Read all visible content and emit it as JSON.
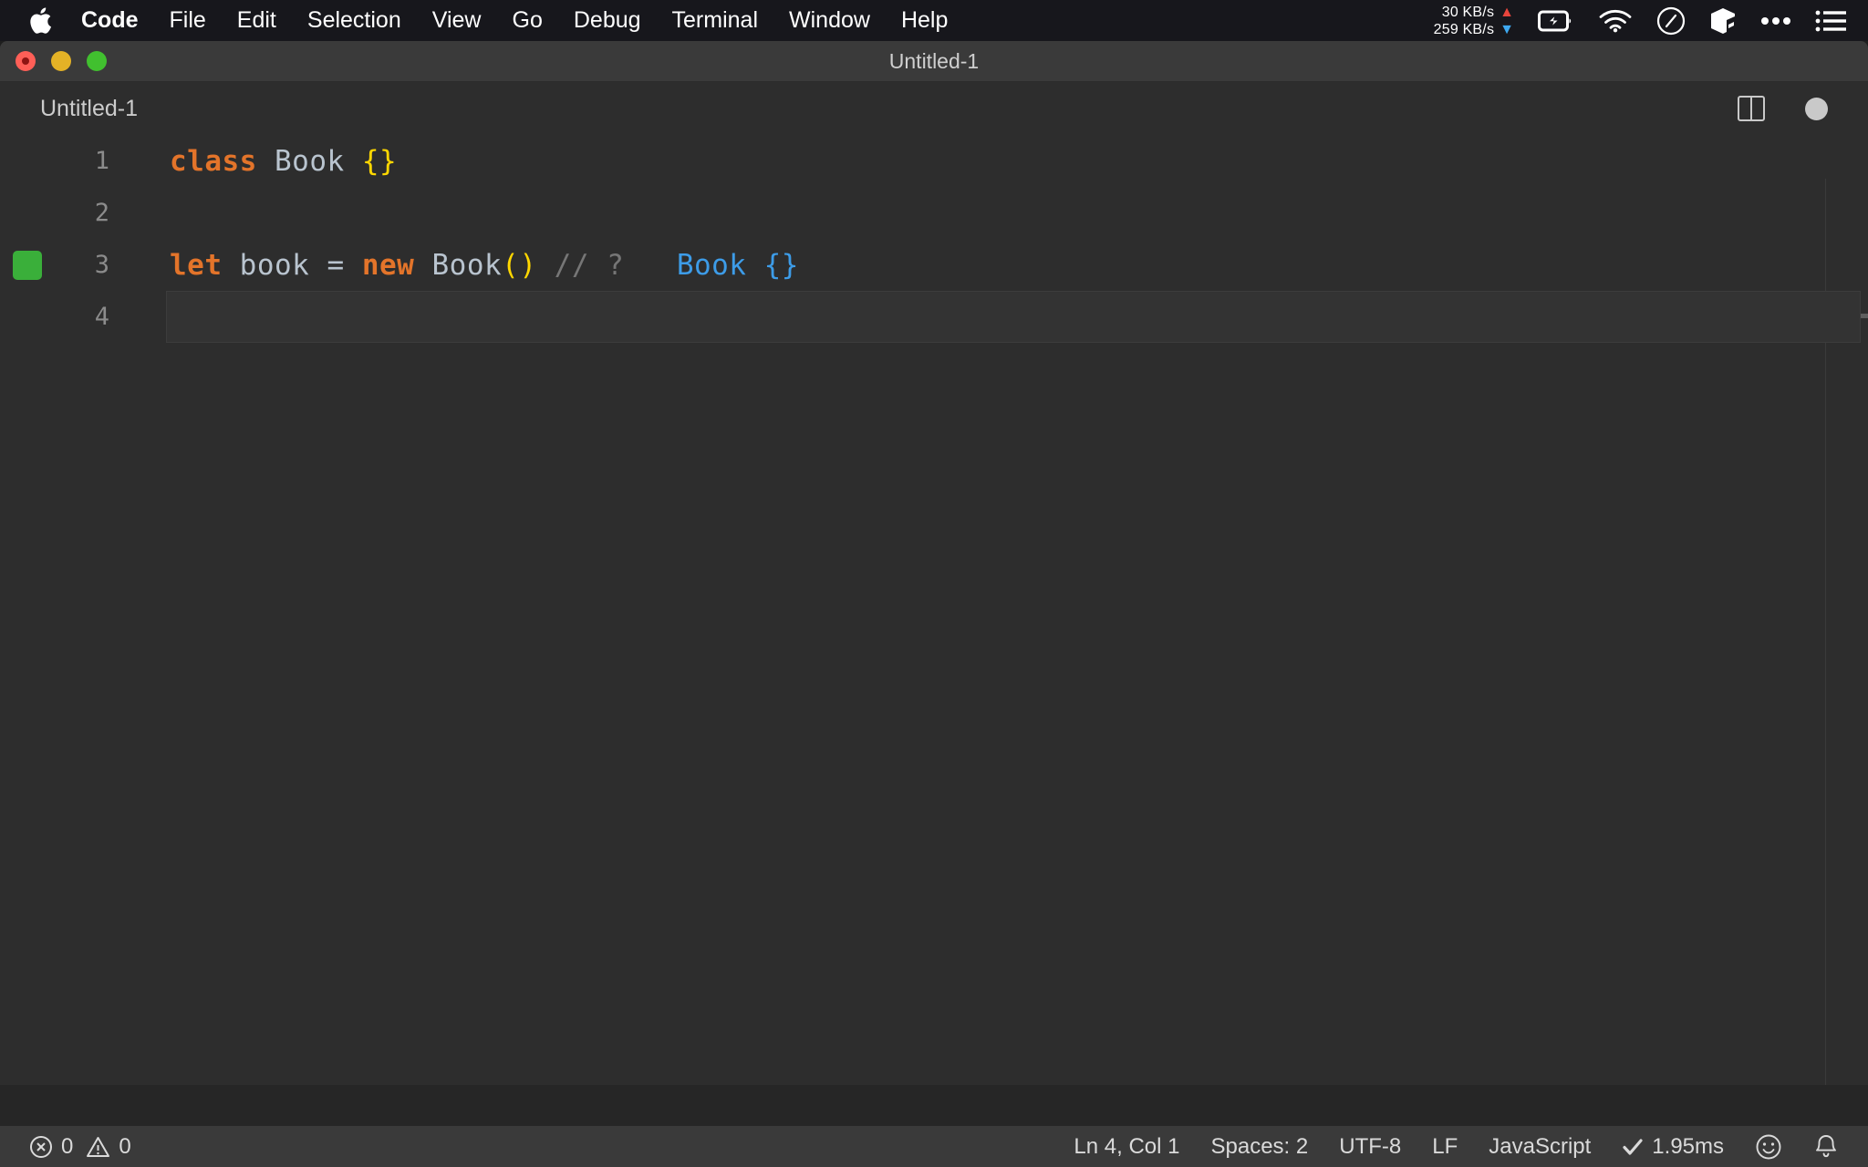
{
  "menubar": {
    "apple_icon": "apple-logo-icon",
    "items": [
      {
        "label": "Code",
        "bold": true
      },
      {
        "label": "File",
        "bold": false
      },
      {
        "label": "Edit",
        "bold": false
      },
      {
        "label": "Selection",
        "bold": false
      },
      {
        "label": "View",
        "bold": false
      },
      {
        "label": "Go",
        "bold": false
      },
      {
        "label": "Debug",
        "bold": false
      },
      {
        "label": "Terminal",
        "bold": false
      },
      {
        "label": "Window",
        "bold": false
      },
      {
        "label": "Help",
        "bold": false
      }
    ],
    "status": {
      "net_up": "30 KB/s",
      "net_down": "259 KB/s",
      "arrow_up": "▲",
      "arrow_down": "▼",
      "up_color": "#e8453c",
      "down_color": "#3ea8f0",
      "icons": [
        "battery-charging-icon",
        "wifi-icon",
        "do-not-disturb-icon",
        "cube-icon",
        "ellipsis-icon",
        "menu-list-icon"
      ]
    }
  },
  "window": {
    "title": "Untitled-1",
    "traffic_lights": [
      "close-button",
      "minimize-button",
      "maximize-button"
    ]
  },
  "tabs": {
    "items": [
      {
        "label": "Untitled-1",
        "active": true,
        "dirty": true
      }
    ],
    "actions": [
      "split-editor-icon",
      "unsaved-dot-icon"
    ]
  },
  "editor": {
    "language": "JavaScript",
    "lines": [
      {
        "number": "1",
        "marker": false,
        "current": false,
        "tokens": [
          {
            "text": "class",
            "type": "keyword"
          },
          {
            "text": " ",
            "type": "op"
          },
          {
            "text": "Book",
            "type": "type"
          },
          {
            "text": " ",
            "type": "op"
          },
          {
            "text": "{}",
            "type": "brace"
          }
        ]
      },
      {
        "number": "2",
        "marker": false,
        "current": false,
        "tokens": []
      },
      {
        "number": "3",
        "marker": true,
        "current": false,
        "tokens": [
          {
            "text": "let",
            "type": "keyword"
          },
          {
            "text": " ",
            "type": "op"
          },
          {
            "text": "book",
            "type": "var"
          },
          {
            "text": " = ",
            "type": "op"
          },
          {
            "text": "new",
            "type": "keyword"
          },
          {
            "text": " ",
            "type": "op"
          },
          {
            "text": "Book",
            "type": "type"
          },
          {
            "text": "()",
            "type": "paren"
          },
          {
            "text": " ",
            "type": "op"
          },
          {
            "text": "// ?",
            "type": "comment"
          },
          {
            "text": "   ",
            "type": "op"
          },
          {
            "text": "Book {}",
            "type": "inline"
          }
        ]
      },
      {
        "number": "4",
        "marker": false,
        "current": true,
        "tokens": []
      }
    ]
  },
  "statusbar": {
    "left": [
      {
        "icon": "error-icon",
        "label": "0"
      },
      {
        "icon": "warning-icon",
        "label": "0"
      }
    ],
    "right": [
      {
        "icon": "",
        "label": "Ln 4, Col 1"
      },
      {
        "icon": "",
        "label": "Spaces: 2"
      },
      {
        "icon": "",
        "label": "UTF-8"
      },
      {
        "icon": "",
        "label": "LF"
      },
      {
        "icon": "",
        "label": "JavaScript"
      },
      {
        "icon": "check-icon",
        "label": "1.95ms"
      }
    ],
    "icons": [
      "smiley-feedback-icon",
      "bell-notifications-icon"
    ]
  },
  "colors": {
    "editor_bg": "#2d2d2d",
    "titlebar_bg": "#3a3a3a",
    "keyword": "#e3742a",
    "brace": "#ffd700",
    "inline_value": "#3d9ce8",
    "comment": "#767676",
    "gutter_marker": "#3aaf3a"
  }
}
